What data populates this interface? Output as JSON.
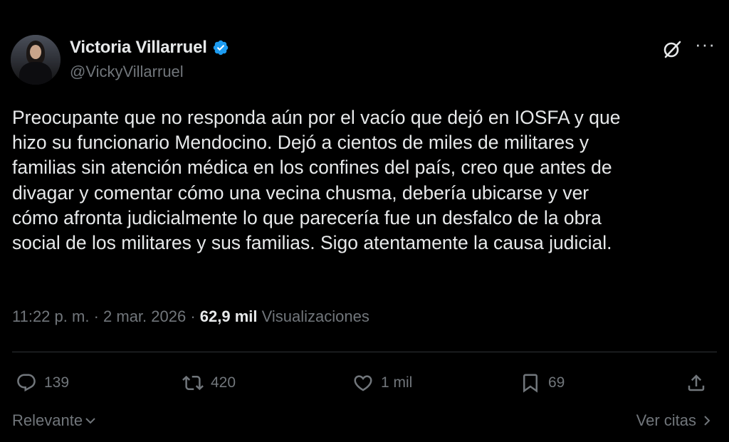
{
  "author": {
    "display_name": "Victoria Villarruel",
    "handle": "@VickyVillarruel",
    "verified": true
  },
  "tweet": {
    "lines": [
      "Preocupante que no responda aún por el vacío que dejó en IOSFA y que",
      "hizo su funcionario Mendocino. Dejó a cientos de miles de militares y",
      "familias sin atención médica en los confines del país, creo que antes de",
      "divagar y comentar cómo una  vecina chusma, debería ubicarse y ver",
      "cómo afronta judicialmente lo que parecería fue un desfalco de la obra",
      "social de los militares y sus familias. Sigo atentamente la causa judicial."
    ]
  },
  "meta": {
    "time": "11:22 p. m.",
    "sep1": "·",
    "date": "2 mar. 2026",
    "sep2": "·",
    "views_count": "62,9 mil",
    "views_label": "Visualizaciones"
  },
  "actions": {
    "replies": "139",
    "reposts": "420",
    "likes": "1 mil",
    "bookmarks": "69"
  },
  "footer": {
    "sort_label": "Relevante",
    "quotes_label": "Ver citas"
  },
  "icons": {
    "verified": "verified-badge-icon",
    "grok": "grok-icon",
    "more": "more-icon",
    "reply": "reply-icon",
    "repost": "repost-icon",
    "like": "heart-icon",
    "bookmark": "bookmark-icon",
    "share": "share-icon"
  },
  "colors": {
    "background": "#000000",
    "text": "#e7e9ea",
    "secondary": "#71767b",
    "verified": "#1d9bf0"
  }
}
